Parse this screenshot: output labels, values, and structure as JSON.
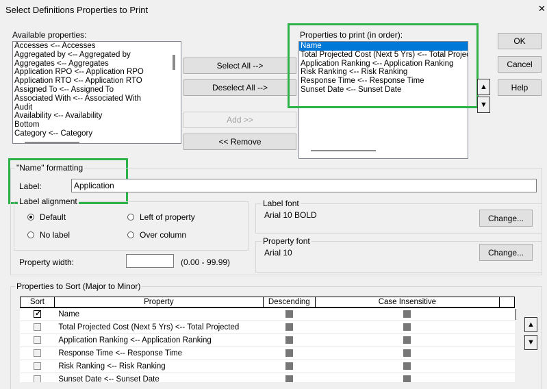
{
  "dialog": {
    "title": "Select Definitions Properties to Print",
    "close_glyph": "✕"
  },
  "available": {
    "label": "Available properties:",
    "items": [
      "Accesses <-- Accesses",
      "Aggregated by <-- Aggregated by",
      "Aggregates <-- Aggregates",
      "Application RPO <-- Application RPO",
      "Application RTO <-- Application RTO",
      "Assigned To <-- Assigned To",
      "Associated With <-- Associated With",
      "Audit",
      "Availability <-- Availability",
      "Bottom",
      "Category <-- Category"
    ]
  },
  "middle_buttons": {
    "select_all": "Select All -->",
    "deselect_all": "Deselect All -->",
    "add": "Add >>",
    "remove": "<< Remove"
  },
  "to_print": {
    "label": "Properties to print (in order):",
    "items": [
      "Name",
      "Total Projected Cost (Next 5 Yrs) <-- Total Projec",
      "Application Ranking <-- Application Ranking",
      "Risk Ranking <-- Risk Ranking",
      "Response Time <-- Response Time",
      "Sunset Date <-- Sunset Date"
    ],
    "selected_index": 0
  },
  "right_buttons": {
    "ok": "OK",
    "cancel": "Cancel",
    "help": "Help",
    "up_glyph": "▲",
    "down_glyph": "▼"
  },
  "formatting": {
    "title": "\"Name\" formatting",
    "label_caption": "Label:",
    "label_value": "Application",
    "alignment_title": "Label alignment",
    "options": {
      "default": "Default",
      "left_of_property": "Left of property",
      "no_label": "No label",
      "over_column": "Over column"
    },
    "selected_option": "default",
    "label_font_title": "Label font",
    "label_font_value": "Arial 10 BOLD",
    "property_font_title": "Property font",
    "property_font_value": "Arial 10",
    "change_label": "Change...",
    "property_width_caption": "Property width:",
    "property_width_value": "",
    "property_width_range": "(0.00 - 99.99)"
  },
  "sort": {
    "title": "Properties to Sort (Major to Minor)",
    "headers": [
      "Sort",
      "Property",
      "Descending",
      "Case Insensitive"
    ],
    "rows": [
      {
        "sort": true,
        "property": "Name"
      },
      {
        "sort": false,
        "property": "Total Projected Cost (Next 5 Yrs) <-- Total Projected"
      },
      {
        "sort": false,
        "property": "Application Ranking <-- Application Ranking"
      },
      {
        "sort": false,
        "property": "Response Time <-- Response Time"
      },
      {
        "sort": false,
        "property": "Risk Ranking <-- Risk Ranking"
      },
      {
        "sort": false,
        "property": "Sunset Date <-- Sunset Date"
      }
    ],
    "up_glyph": "▲",
    "down_glyph": "▼"
  },
  "colors": {
    "highlight": "#2db24a",
    "selection": "#0078d7"
  }
}
